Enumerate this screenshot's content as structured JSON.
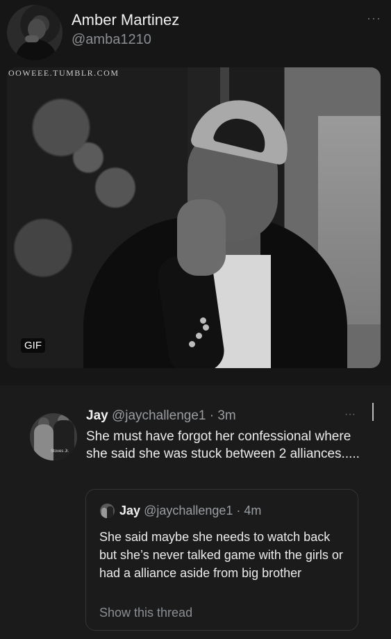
{
  "tweet": {
    "author_name": "Amber Martinez",
    "author_handle": "@amba1210",
    "more_icon": "more-horizontal-icon",
    "more_glyph": "···",
    "media": {
      "watermark": "OOWEEE.TUMBLR.COM",
      "badge": "GIF"
    }
  },
  "reply": {
    "name": "Jay",
    "meta": "@jaychallenge1 · 3m",
    "more_glyph": "···",
    "text": "She must have forgot her confessional where she said she was stuck between 2 alliances.....",
    "avatar_caption": "Stoves Jr.",
    "quote": {
      "name": "Jay",
      "meta": "@jaychallenge1 · 4m",
      "text": "She said maybe she needs to watch back but she’s never talked game with the girls or had a alliance aside from big brother",
      "link": "Show this thread"
    }
  },
  "colors": {
    "background": "#121212",
    "secondary_text": "#8b8f93"
  }
}
